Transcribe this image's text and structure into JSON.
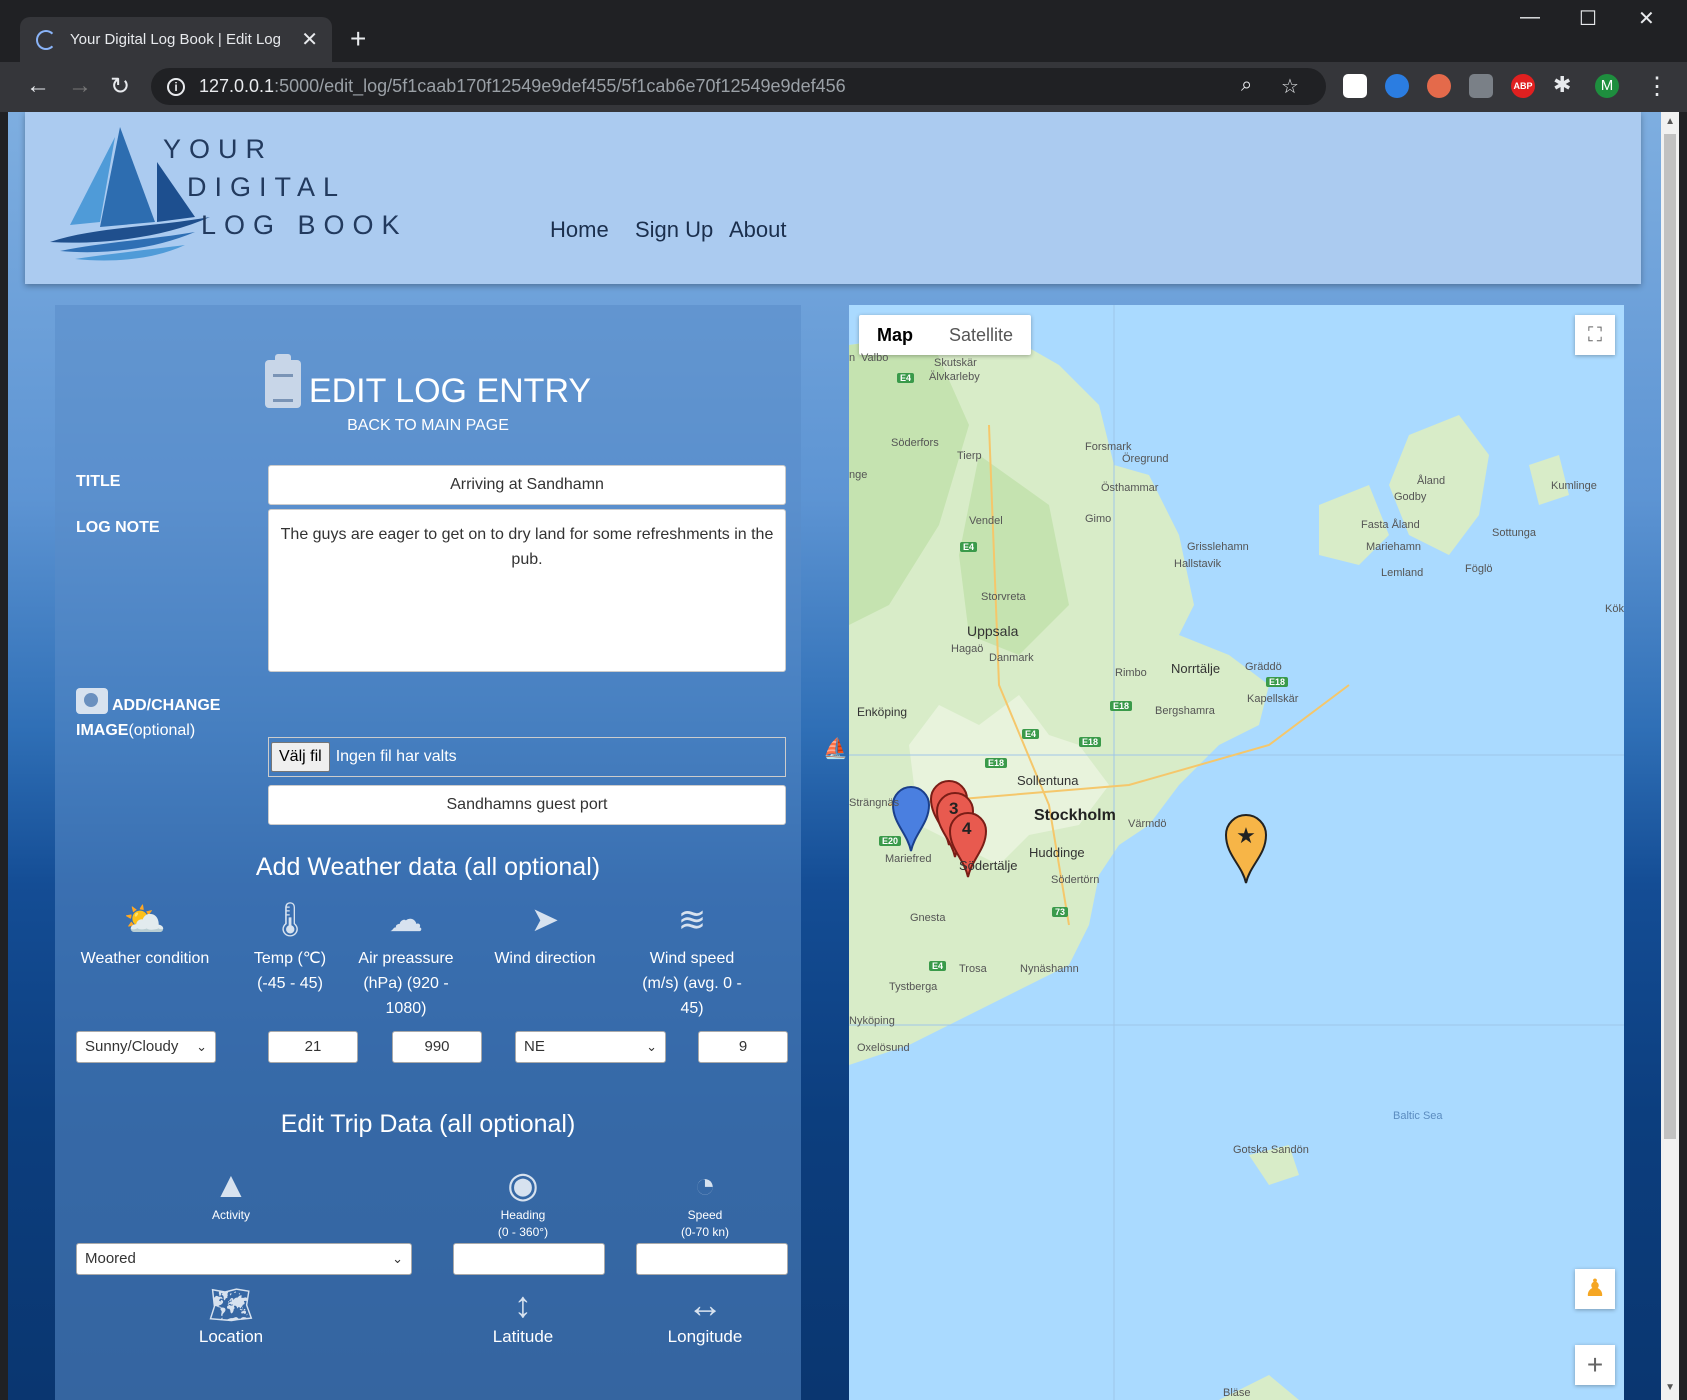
{
  "browser": {
    "tab_title": "Your Digital Log Book | Edit Log",
    "url_host": "127.0.0.1",
    "url_path": ":5000/edit_log/5f1caab170f12549e9def455/5f1cab6e70f12549e9def456",
    "profile_initial": "M",
    "abp_label": "ABP"
  },
  "site": {
    "logo_lines": [
      "YOUR",
      "DIGITAL",
      "LOG BOOK"
    ],
    "nav": [
      "Home",
      "Sign Up",
      "About"
    ]
  },
  "form": {
    "heading": "EDIT LOG ENTRY",
    "back_link": "BACK TO MAIN PAGE",
    "title_label": "TITLE",
    "title_value": "Arriving at Sandhamn",
    "note_label": "LOG NOTE",
    "note_value": "The guys are eager to get on to dry land for some refreshments in the pub.",
    "image_label_bold_1": "ADD/CHANGE",
    "image_label_bold_2": "IMAGE",
    "image_label_rest": "(optional)",
    "file_button": "Välj fil",
    "file_status": "Ingen fil har valts",
    "location_name": "Sandhamns guest port",
    "weather_heading": "Add Weather data (all optional)",
    "weather": [
      {
        "icon": "sun-cloud-icon",
        "label": "Weather condition"
      },
      {
        "icon": "thermometer-icon",
        "label": "Temp (℃) (-45 - 45)"
      },
      {
        "icon": "cloud-upload-icon",
        "label": "Air preassure (hPa) (920 - 1080)"
      },
      {
        "icon": "paper-plane-icon",
        "label": "Wind direction"
      },
      {
        "icon": "wind-icon",
        "label": "Wind speed (m/s) (avg. 0 - 45)"
      }
    ],
    "weather_condition": "Sunny/Cloudy",
    "temp": "21",
    "pressure": "990",
    "wind_direction": "NE",
    "wind_speed": "9",
    "trip_heading": "Edit Trip Data (all optional)",
    "activity_label": "Activity",
    "heading_label_1": "Heading",
    "heading_label_2": "(0 - 360°)",
    "speed_label_1": "Speed",
    "speed_label_2": "(0-70 kn)",
    "activity_value": "Moored",
    "location_label": "Location",
    "latitude_label": "Latitude",
    "longitude_label": "Longitude"
  },
  "map": {
    "type_map": "Map",
    "type_satellite": "Satellite",
    "markers": [
      "3",
      "4"
    ],
    "places": [
      "Valbo",
      "Skutskär",
      "Älvkarleby",
      "Söderfors",
      "Tierp",
      "Forsmark",
      "Öregrund",
      "Östhammar",
      "Vendel",
      "Gimo",
      "Grisslehamn",
      "Hallstavik",
      "Storvreta",
      "Uppsala",
      "Hagaö",
      "Danmark",
      "Rimbo",
      "Norrtälje",
      "Gräddö",
      "Kapellskär",
      "Bergshamra",
      "Enköping",
      "Sollentuna",
      "Strängnäs",
      "Stockholm",
      "Värmdö",
      "Mariefred",
      "Huddinge",
      "Södertälje",
      "Södertörn",
      "Gnesta",
      "Trosa",
      "Nynäshamn",
      "Tystberga",
      "Nyköping",
      "Oxelösund",
      "Åland",
      "Godby",
      "Kumlinge",
      "Fasta Åland",
      "Mariehamn",
      "Sottunga",
      "Lemland",
      "Föglö",
      "Kök",
      "Gotska Sandön",
      "Bläse",
      "nge",
      "n"
    ],
    "sea_label": "Baltic Sea",
    "roads": [
      "E4",
      "E4",
      "E18",
      "E18",
      "E4",
      "E18",
      "E18",
      "E20",
      "73",
      "E4"
    ]
  }
}
